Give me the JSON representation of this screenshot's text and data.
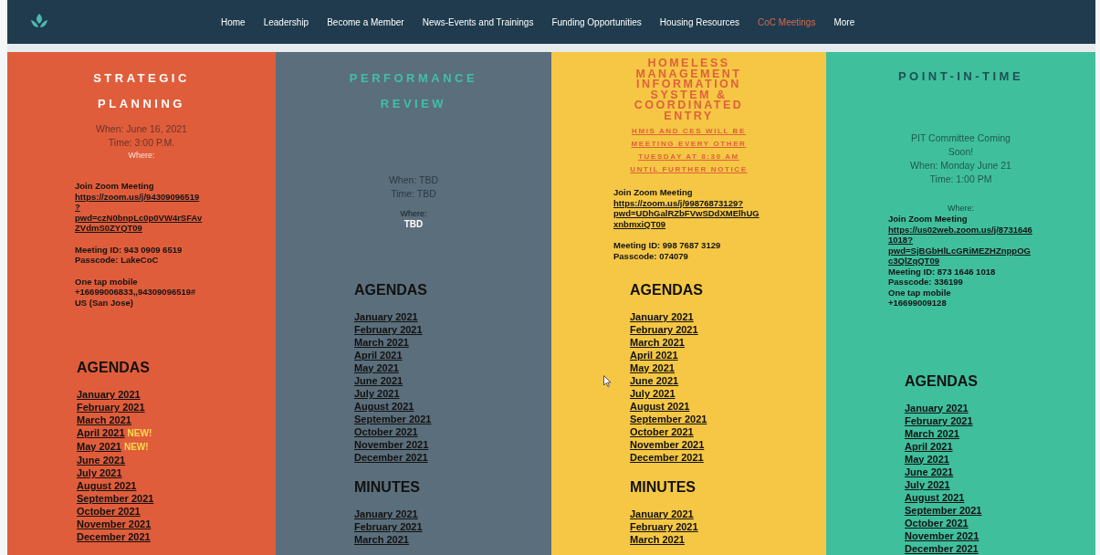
{
  "nav": {
    "items": [
      {
        "label": "Home",
        "selected": false
      },
      {
        "label": "Leadership",
        "selected": false
      },
      {
        "label": "Become a Member",
        "selected": false
      },
      {
        "label": "News-Events and Trainings",
        "selected": false
      },
      {
        "label": "Funding Opportunities",
        "selected": false
      },
      {
        "label": "Housing Resources",
        "selected": false
      },
      {
        "label": "CoC Meetings",
        "selected": true
      },
      {
        "label": "More",
        "selected": false
      }
    ]
  },
  "columns": [
    {
      "color": "#e05d3b",
      "blocks": [
        {
          "kind": "title",
          "lines": [
            "STRATEGIC",
            "PLANNING"
          ]
        },
        {
          "kind": "info",
          "lines": [
            "When: June 16, 2021",
            "Time: 3:00 P.M."
          ]
        },
        {
          "kind": "where",
          "label": "Where:"
        },
        {
          "kind": "zoom",
          "paragraphs": [
            [
              {
                "kind": "text",
                "text": "Join Zoom Meeting"
              },
              {
                "kind": "link",
                "text": "https://zoom.us/j/94309096519?pwd=czN0bnpLc0p0VW4rSFAvZVdmS0ZYQT09"
              }
            ],
            [
              {
                "kind": "text",
                "text": "Meeting ID: 943 0909 6519"
              },
              {
                "kind": "text",
                "text": "Passcode: LakeCoC"
              }
            ],
            [
              {
                "kind": "text",
                "text": "One tap mobile"
              },
              {
                "kind": "text",
                "text": "+16699006833,,94309096519# US (San Jose)"
              }
            ]
          ]
        },
        {
          "kind": "heading",
          "text": "AGENDAS"
        },
        {
          "kind": "links",
          "items": [
            {
              "label": "January 2021"
            },
            {
              "label": "February 2021"
            },
            {
              "label": "March 2021"
            },
            {
              "label": "April 2021",
              "badge": "NEW!"
            },
            {
              "label": "May 2021",
              "badge": "NEW!"
            },
            {
              "label": "June 2021"
            },
            {
              "label": "July 2021"
            },
            {
              "label": "August 2021"
            },
            {
              "label": "September 2021"
            },
            {
              "label": "October 2021"
            },
            {
              "label": "November 2021"
            },
            {
              "label": "December 2021"
            }
          ]
        }
      ]
    },
    {
      "color": "#5b6e7b",
      "blocks": [
        {
          "kind": "title",
          "lines": [
            "PERFORMANCE",
            "REVIEW"
          ]
        },
        {
          "kind": "info",
          "lines": [
            "When: TBD",
            "Time: TBD"
          ]
        },
        {
          "kind": "where",
          "label": "Where:",
          "value": "TBD"
        },
        {
          "kind": "heading",
          "text": "AGENDAS"
        },
        {
          "kind": "links",
          "items": [
            {
              "label": "January 2021"
            },
            {
              "label": "February 2021"
            },
            {
              "label": "March 2021"
            },
            {
              "label": "April 2021"
            },
            {
              "label": "May 2021"
            },
            {
              "label": "June 2021"
            },
            {
              "label": "July 2021"
            },
            {
              "label": "August 2021"
            },
            {
              "label": "September 2021"
            },
            {
              "label": "October 2021"
            },
            {
              "label": "November 2021"
            },
            {
              "label": "December 2021"
            }
          ]
        },
        {
          "kind": "heading",
          "text": "MINUTES"
        },
        {
          "kind": "links",
          "items": [
            {
              "label": "January 2021"
            },
            {
              "label": "February 2021"
            },
            {
              "label": "March 2021"
            }
          ]
        }
      ]
    },
    {
      "color": "#f5c744",
      "blocks": [
        {
          "kind": "title",
          "lines": [
            "HOMELESS",
            "MANAGEMENT",
            "INFORMATION",
            "SYSTEM &",
            "COORDINATED",
            "ENTRY"
          ]
        },
        {
          "kind": "subtitle",
          "lines": [
            "HMIS AND CES WILL BE",
            "MEETING EVERY OTHER",
            "TUESDAY AT 8:30 AM",
            "UNTIL FURTHER NOTICE"
          ]
        },
        {
          "kind": "zoom",
          "paragraphs": [
            [
              {
                "kind": "text",
                "text": "Join Zoom Meeting"
              },
              {
                "kind": "link",
                "text": "https://zoom.us/j/99876873129?pwd=UDhGalRZbFVwSDdXMElhUGxnbmxiQT09"
              }
            ],
            [
              {
                "kind": "text",
                "text": "Meeting ID: 998 7687 3129"
              },
              {
                "kind": "text",
                "text": "Passcode: 074079"
              }
            ]
          ]
        },
        {
          "kind": "heading",
          "text": "AGENDAS"
        },
        {
          "kind": "links",
          "items": [
            {
              "label": "January 2021"
            },
            {
              "label": "February 2021"
            },
            {
              "label": "March 2021"
            },
            {
              "label": "April 2021"
            },
            {
              "label": "May 2021"
            },
            {
              "label": "June 2021"
            },
            {
              "label": "July 2021"
            },
            {
              "label": "August 2021"
            },
            {
              "label": "September 2021"
            },
            {
              "label": "October 2021"
            },
            {
              "label": "November 2021"
            },
            {
              "label": "December 2021"
            }
          ]
        },
        {
          "kind": "heading",
          "text": "MINUTES"
        },
        {
          "kind": "links",
          "items": [
            {
              "label": "January 2021"
            },
            {
              "label": "February 2021"
            },
            {
              "label": "March 2021"
            }
          ]
        }
      ]
    },
    {
      "color": "#40bf9d",
      "blocks": [
        {
          "kind": "title",
          "lines": [
            "POINT-IN-TIME"
          ]
        },
        {
          "kind": "info",
          "lines": [
            "PIT Committee Coming Soon!",
            "When: Monday June 21",
            "Time: 1:00 PM"
          ]
        },
        {
          "kind": "where",
          "label": "Where:"
        },
        {
          "kind": "zoom",
          "paragraphs": [
            [
              {
                "kind": "text",
                "text": "Join Zoom Meeting"
              },
              {
                "kind": "link",
                "text": "https://us02web.zoom.us/j/87316461018?pwd=SjBGbHlLcGRiMEZHZnppOGc3QlZqQT09"
              }
            ],
            [
              {
                "kind": "text",
                "text": "Meeting ID: 873 1646 1018"
              },
              {
                "kind": "text",
                "text": "Passcode: 336199"
              },
              {
                "kind": "text",
                "text": "One tap mobile"
              },
              {
                "kind": "text",
                "text": "+16699009128"
              }
            ]
          ]
        },
        {
          "kind": "heading",
          "text": "AGENDAS"
        },
        {
          "kind": "links",
          "items": [
            {
              "label": "January 2021"
            },
            {
              "label": "February 2021"
            },
            {
              "label": "March 2021"
            },
            {
              "label": "April 2021"
            },
            {
              "label": "May 2021"
            },
            {
              "label": "June 2021"
            },
            {
              "label": "July 2021"
            },
            {
              "label": "August 2021"
            },
            {
              "label": "September 2021"
            },
            {
              "label": "October 2021"
            },
            {
              "label": "November 2021"
            },
            {
              "label": "December 2021"
            }
          ]
        }
      ]
    }
  ]
}
